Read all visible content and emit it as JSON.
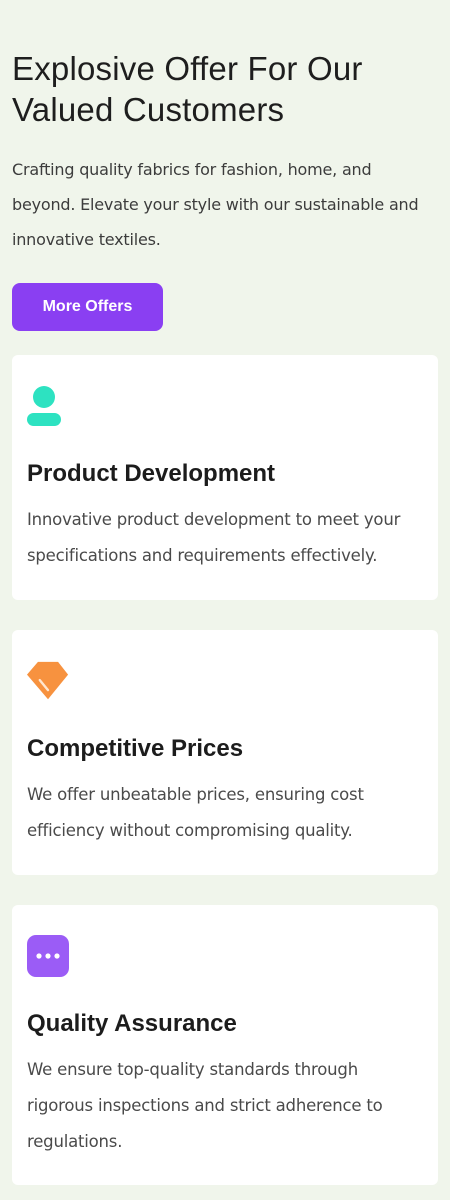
{
  "hero": {
    "title": "Explosive Offer For Our Valued Customers",
    "description": "Crafting quality fabrics for fashion, home, and beyond. Elevate your style with our sustainable and innovative textiles.",
    "cta_label": "More Offers",
    "accent_color": "#8a3ff2"
  },
  "features": [
    {
      "icon": "person-icon",
      "icon_color": "#2de2c1",
      "title": "Product Development",
      "description": "Innovative product development to meet your specifications and requirements effectively."
    },
    {
      "icon": "price-tag-icon",
      "icon_color": "#f7923f",
      "title": "Competitive Prices",
      "description": "We offer unbeatable prices, ensuring cost efficiency without compromising quality."
    },
    {
      "icon": "chat-dots-icon",
      "icon_color": "#9b5cf6",
      "title": "Quality Assurance",
      "description": "We ensure top-quality standards through rigorous inspections and strict adherence to regulations."
    }
  ]
}
